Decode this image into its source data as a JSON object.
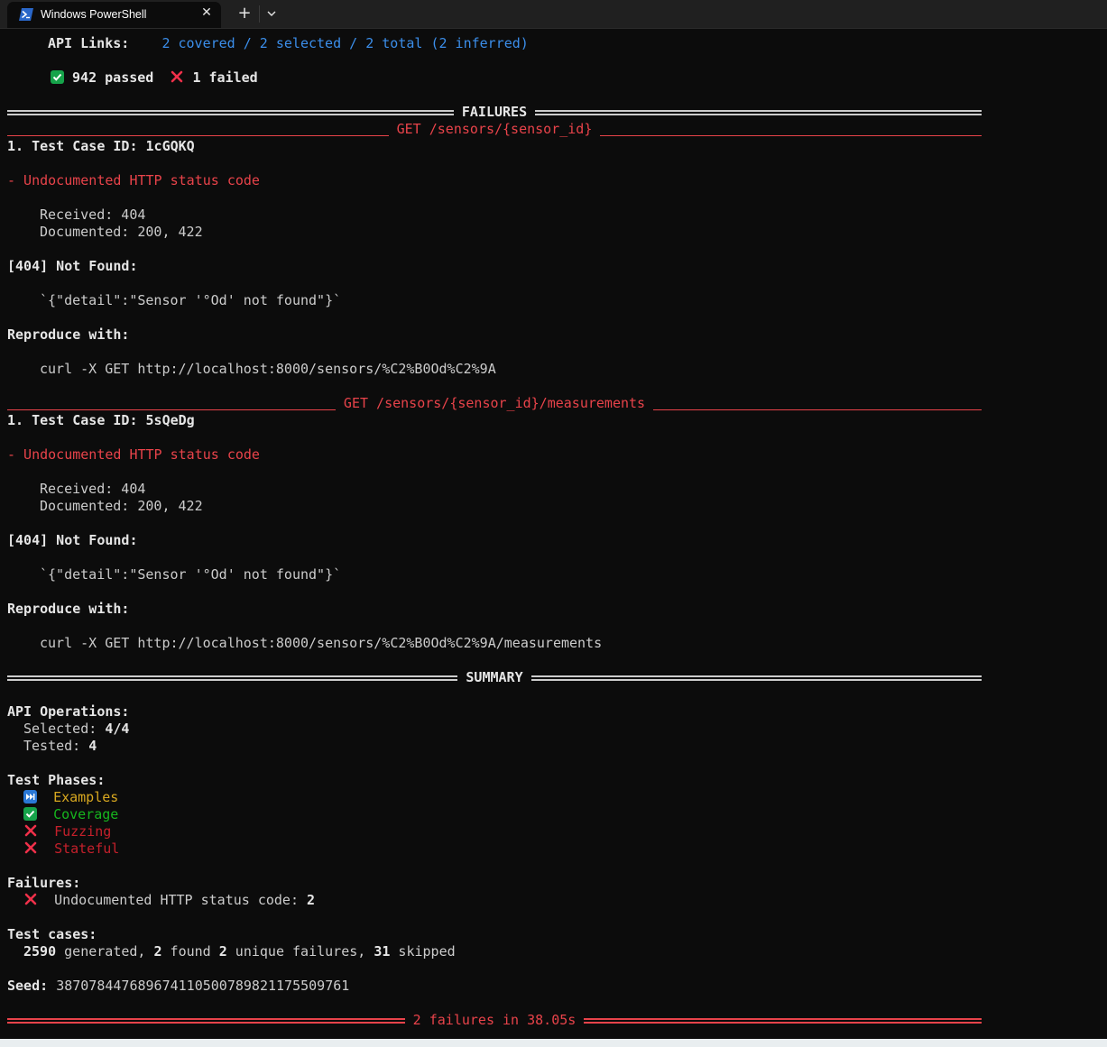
{
  "window": {
    "tab_title": "Windows PowerShell",
    "accent": "#3b8eea"
  },
  "top": {
    "api_links_label": "API Links:",
    "api_links_value": "2 covered / 2 selected / 2 total (2 inferred)",
    "passed": "942 passed",
    "failed": "1 failed"
  },
  "failures_header": " FAILURES ",
  "failure_groups": [
    {
      "endpoint": " GET /sensors/{sensor_id} ",
      "test_case": "1. Test Case ID: 1cGQKQ",
      "check": "- Undocumented HTTP status code",
      "received": "Received: 404",
      "documented": "Documented: 200, 422",
      "response_status": "[404] Not Found:",
      "response_body": "`{\"detail\":\"Sensor '°Od' not found\"}`",
      "reproduce_label": "Reproduce with:",
      "curl": "curl -X GET http://localhost:8000/sensors/%C2%B0Od%C2%9A"
    },
    {
      "endpoint": " GET /sensors/{sensor_id}/measurements ",
      "test_case": "1. Test Case ID: 5sQeDg",
      "check": "- Undocumented HTTP status code",
      "received": "Received: 404",
      "documented": "Documented: 200, 422",
      "response_status": "[404] Not Found:",
      "response_body": "`{\"detail\":\"Sensor '°Od' not found\"}`",
      "reproduce_label": "Reproduce with:",
      "curl": "curl -X GET http://localhost:8000/sensors/%C2%B0Od%C2%9A/measurements"
    }
  ],
  "summary_header": " SUMMARY ",
  "summary": {
    "api_ops_label": "API Operations:",
    "selected_label": "Selected: ",
    "selected_value": "4/4",
    "tested_label": "Tested: ",
    "tested_value": "4",
    "phases_label": "Test Phases:",
    "phases": [
      {
        "name": "Examples",
        "status": "skipped",
        "color": "#d8a820"
      },
      {
        "name": "Coverage",
        "status": "passed",
        "color": "#16b61e"
      },
      {
        "name": "Fuzzing",
        "status": "failed",
        "color": "#c5202b"
      },
      {
        "name": "Stateful",
        "status": "failed",
        "color": "#c5202b"
      }
    ],
    "failures_label": "Failures:",
    "failure_item_label": "Undocumented HTTP status code: ",
    "failure_item_count": "2",
    "test_cases_label": "Test cases:",
    "generated_count": "2590",
    "generated_text": " generated, ",
    "found_count": "2",
    "found_text": " found ",
    "unique_count": "2",
    "unique_text": " unique failures, ",
    "skipped_count": "31",
    "skipped_text": " skipped",
    "seed_label": "Seed: ",
    "seed_value": "387078447689674110500789821175509761"
  },
  "final_line": " 2 failures in 38.05s "
}
